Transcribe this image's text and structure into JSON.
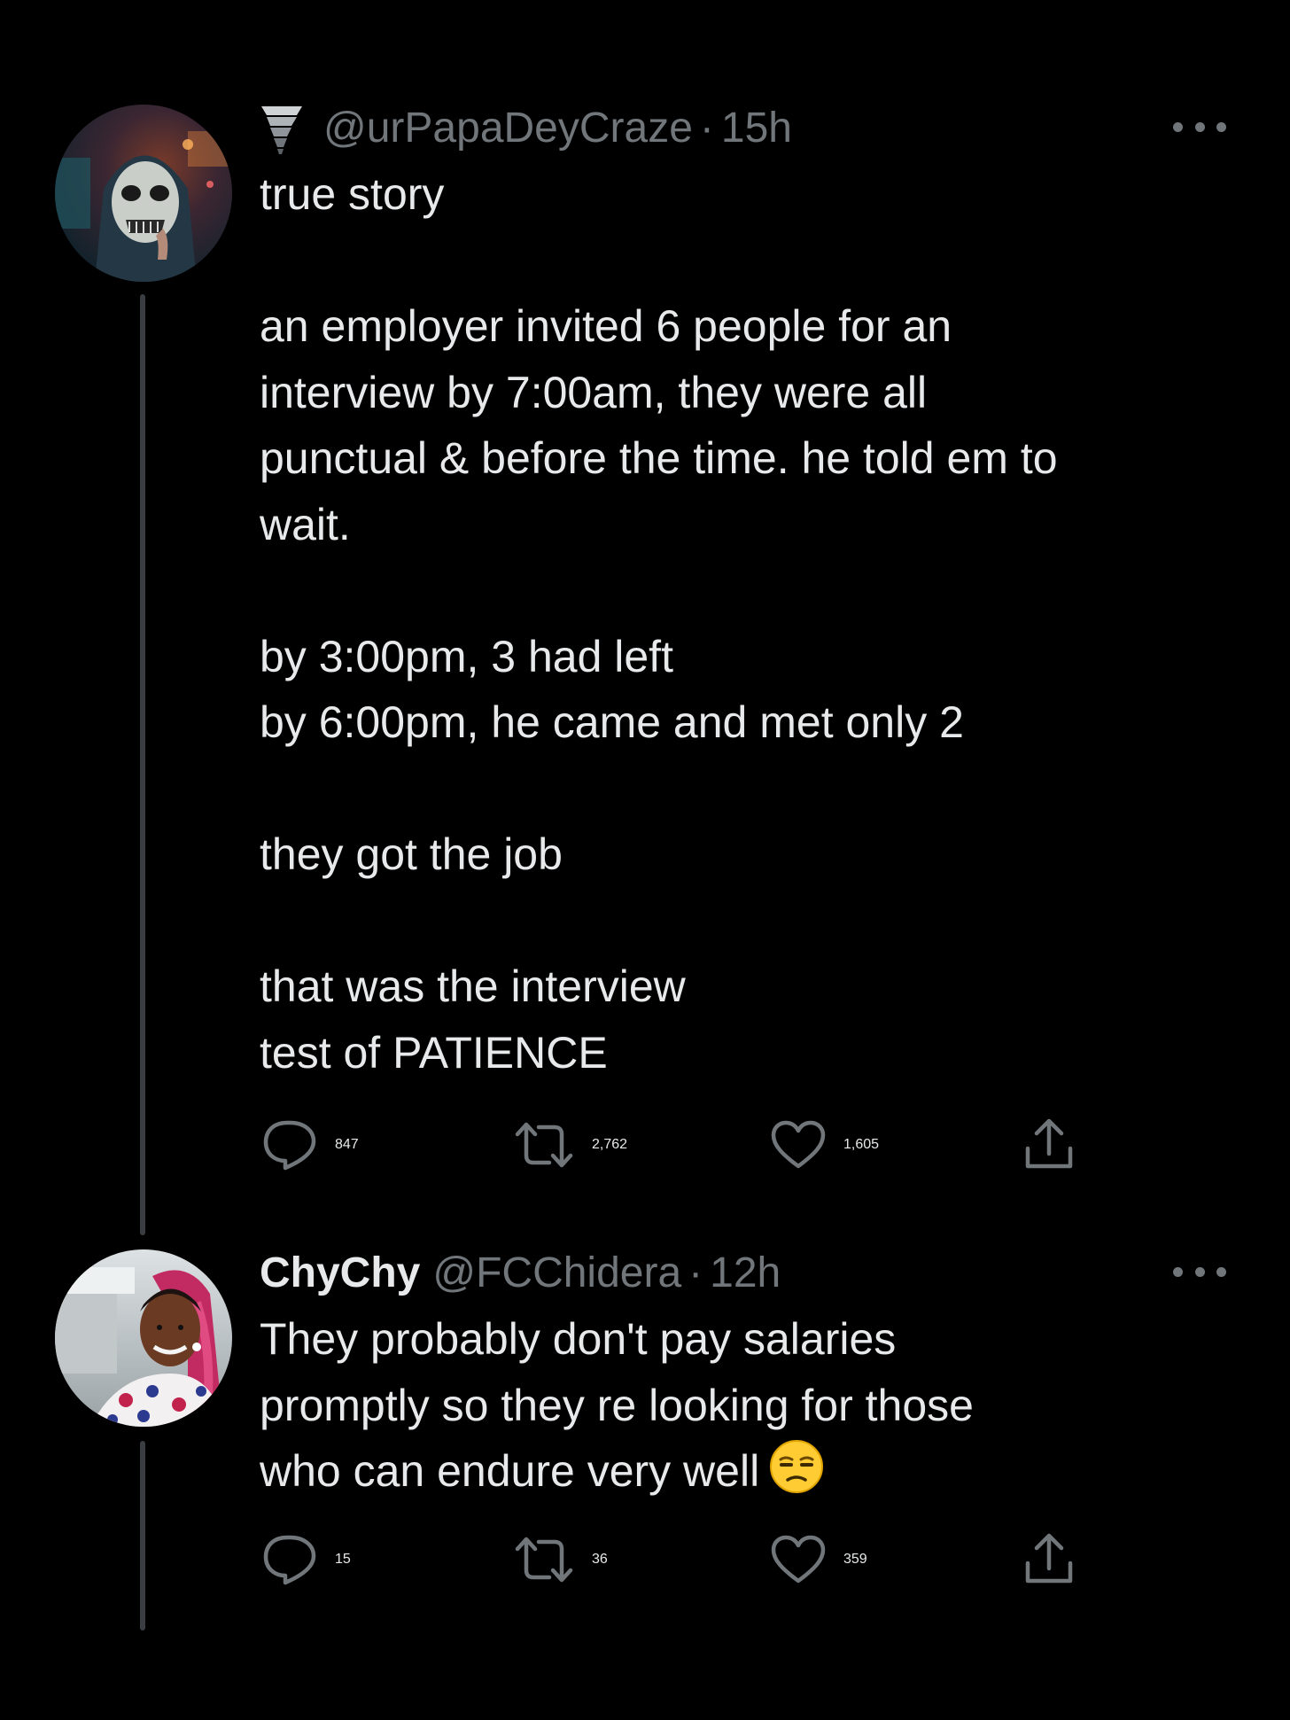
{
  "tweets": [
    {
      "display_name": "",
      "handle": "@urPapaDeyCraze",
      "separator": "·",
      "time": "15h",
      "paragraphs": [
        "true story",
        "",
        "an employer invited 6 people for an",
        "interview by 7:00am, they were all",
        "punctual & before the time. he told em to",
        "wait.",
        "",
        "by 3:00pm, 3 had left",
        "by 6:00pm, he came and met only 2",
        "",
        "they got the job",
        "",
        "that was the interview",
        "test of PATIENCE"
      ],
      "stats": {
        "replies": "847",
        "retweets": "2,762",
        "likes": "1,605"
      },
      "icons": {
        "badge": "tornado-icon",
        "reply": "reply-icon",
        "retweet": "retweet-icon",
        "like": "heart-icon",
        "share": "share-icon",
        "more": "more-options-icon"
      }
    },
    {
      "display_name": "ChyChy",
      "handle": "@FCChidera",
      "separator": "·",
      "time": "12h",
      "paragraphs": [
        "They probably don't pay salaries",
        "promptly so they re looking for those",
        "who can endure very well"
      ],
      "emoji": "unamused-face-emoji",
      "stats": {
        "replies": "15",
        "retweets": "36",
        "likes": "359"
      },
      "icons": {
        "reply": "reply-icon",
        "retweet": "retweet-icon",
        "like": "heart-icon",
        "share": "share-icon",
        "more": "more-options-icon"
      }
    }
  ],
  "colors": {
    "background": "#000000",
    "text": "#e7e9ea",
    "secondary": "#71767b",
    "thread_line": "#3a3d41"
  }
}
